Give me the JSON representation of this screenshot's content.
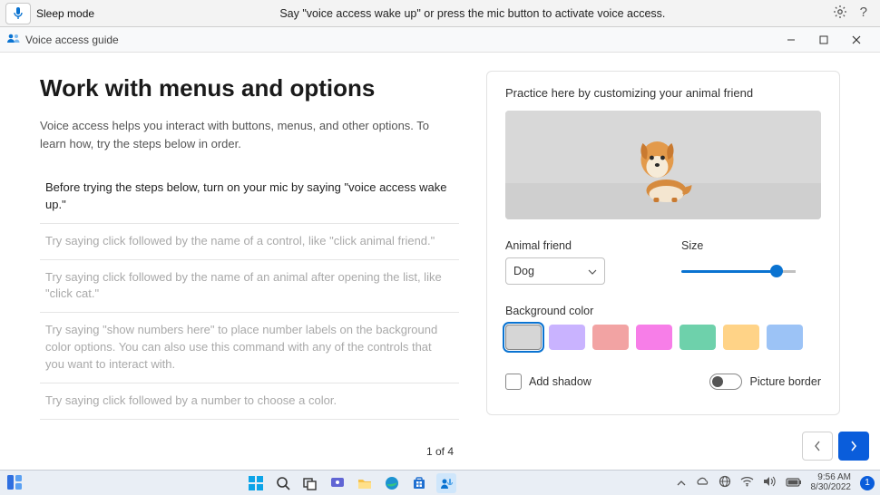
{
  "topbar": {
    "sleep_label": "Sleep mode",
    "message": "Say \"voice access wake up\" or press the mic button to activate voice access."
  },
  "window": {
    "title": "Voice access guide"
  },
  "page": {
    "heading": "Work with menus and options",
    "subtext": "Voice access helps you interact with buttons, menus, and other options. To learn how, try the steps below in order.",
    "steps": [
      "Before trying the steps below, turn on your mic by saying \"voice access wake up.\"",
      "Try saying click followed by the name of a control, like \"click animal friend.\"",
      "Try saying click followed by the name of an animal after opening the list, like \"click cat.\"",
      "Try saying \"show numbers here\" to place number labels on the background color options. You can also use this command with any of the controls that you want to interact with.",
      "Try saying click followed by a number to choose a color."
    ],
    "pager_text": "1 of 4"
  },
  "practice": {
    "title": "Practice here by customizing your animal friend",
    "animal_label": "Animal friend",
    "animal_value": "Dog",
    "size_label": "Size",
    "bg_label": "Background color",
    "colors": {
      "c1": "#d6d6d6",
      "c2": "#c9b3ff",
      "c3": "#f2a3a3",
      "c4": "#f77ee8",
      "c5": "#6ed1ab",
      "c6": "#ffd387",
      "c7": "#9cc3f6"
    },
    "add_shadow_label": "Add shadow",
    "picture_border_label": "Picture border"
  },
  "taskbar": {
    "time": "9:56 AM",
    "date": "8/30/2022"
  }
}
